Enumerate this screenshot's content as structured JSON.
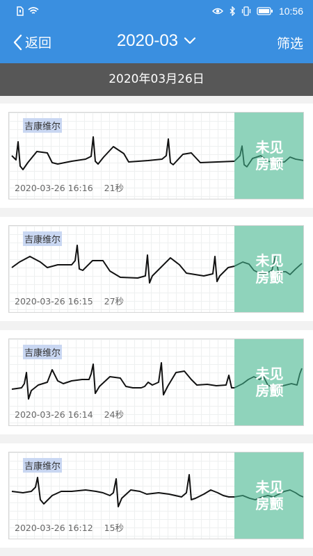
{
  "status_bar": {
    "time": "10:56"
  },
  "nav": {
    "back_label": "返回",
    "month": "2020-03",
    "filter_label": "筛选"
  },
  "date_header": "2020年03月26日",
  "colors": {
    "primary": "#3a8fe0",
    "result_bg": "#8fd3bb",
    "date_bar": "#575757"
  },
  "records": [
    {
      "tag": "吉康维尔",
      "datetime": "2020-03-26 16:16",
      "duration": "21秒",
      "result_line1": "未见",
      "result_line2": "房颤"
    },
    {
      "tag": "吉康维尔",
      "datetime": "2020-03-26 16:15",
      "duration": "27秒",
      "result_line1": "未见",
      "result_line2": "房颤"
    },
    {
      "tag": "吉康维尔",
      "datetime": "2020-03-26 16:14",
      "duration": "24秒",
      "result_line1": "未见",
      "result_line2": "房颤"
    },
    {
      "tag": "吉康维尔",
      "datetime": "2020-03-26 16:12",
      "duration": "15秒",
      "result_line1": "未见",
      "result_line2": "房颤"
    }
  ]
}
